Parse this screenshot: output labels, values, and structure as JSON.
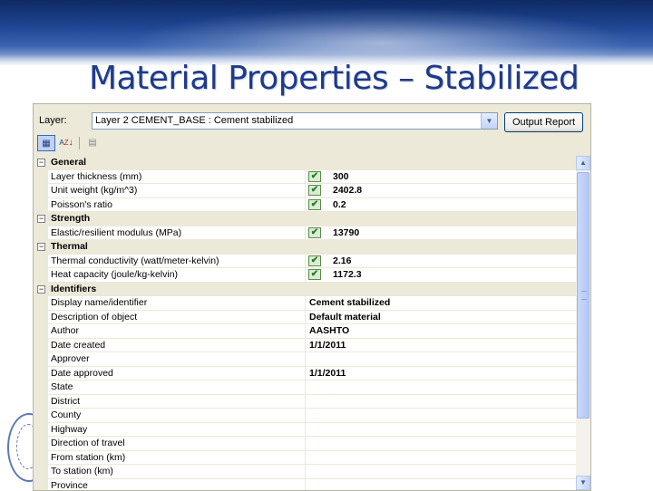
{
  "slide": {
    "title": "Material Properties – Stabilized"
  },
  "window": {
    "layer_label": "Layer:",
    "layer_value": "Layer 2 CEMENT_BASE : Cement stabilized",
    "output_button": "Output Report",
    "toolbar": {
      "categorized_icon": "categorized-view-icon",
      "sort_icon": "alphabetical-sort-icon",
      "pages_icon": "property-pages-icon"
    }
  },
  "categories": [
    {
      "name": "General",
      "rows": [
        {
          "name": "Layer thickness (mm)",
          "value": "300",
          "checked": true
        },
        {
          "name": "Unit weight (kg/m^3)",
          "value": "2402.8",
          "checked": true
        },
        {
          "name": "Poisson's ratio",
          "value": "0.2",
          "checked": true
        }
      ]
    },
    {
      "name": "Strength",
      "rows": [
        {
          "name": "Elastic/resilient modulus (MPa)",
          "value": "13790",
          "checked": true
        }
      ]
    },
    {
      "name": "Thermal",
      "rows": [
        {
          "name": "Thermal conductivity (watt/meter-kelvin)",
          "value": "2.16",
          "checked": true
        },
        {
          "name": "Heat capacity (joule/kg-kelvin)",
          "value": "1172.3",
          "checked": true
        }
      ]
    },
    {
      "name": "Identifiers",
      "rows": [
        {
          "name": "Display name/identifier",
          "value": "Cement stabilized",
          "checked": false
        },
        {
          "name": "Description of object",
          "value": "Default material",
          "checked": false
        },
        {
          "name": "Author",
          "value": "AASHTO",
          "checked": false
        },
        {
          "name": "Date created",
          "value": "1/1/2011",
          "checked": false
        },
        {
          "name": "Approver",
          "value": "",
          "checked": false
        },
        {
          "name": "Date approved",
          "value": "1/1/2011",
          "checked": false
        },
        {
          "name": "State",
          "value": "",
          "checked": false
        },
        {
          "name": "District",
          "value": "",
          "checked": false
        },
        {
          "name": "County",
          "value": "",
          "checked": false
        },
        {
          "name": "Highway",
          "value": "",
          "checked": false
        },
        {
          "name": "Direction of travel",
          "value": "",
          "checked": false
        },
        {
          "name": "From station (km)",
          "value": "",
          "checked": false
        },
        {
          "name": "To station (km)",
          "value": "",
          "checked": false
        },
        {
          "name": "Province",
          "value": "",
          "checked": false
        }
      ]
    }
  ],
  "colors": {
    "title": "#1f3a8a",
    "check": "#1e7f1e",
    "category_bg": "#ece9d8"
  }
}
